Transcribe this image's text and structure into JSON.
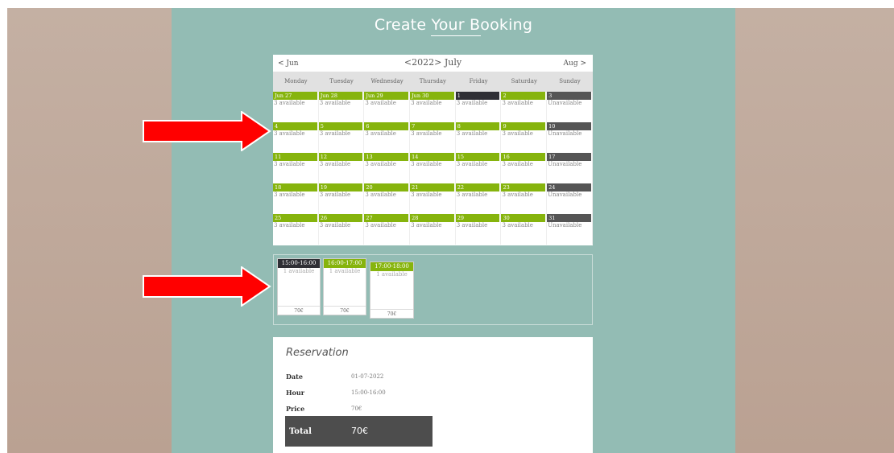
{
  "page": {
    "title": "Create Your Booking"
  },
  "calendar": {
    "prev_label": "< Jun",
    "month_label": "<2022> July",
    "next_label": "Aug >",
    "weekdays": [
      "Monday",
      "Tuesday",
      "Wednesday",
      "Thursday",
      "Friday",
      "Saturday",
      "Sunday"
    ],
    "weeks": [
      [
        {
          "date": "Jun 27",
          "avail": "3 available",
          "state": "available"
        },
        {
          "date": "Jun 28",
          "avail": "3 available",
          "state": "available"
        },
        {
          "date": "Jun 29",
          "avail": "3 available",
          "state": "available"
        },
        {
          "date": "Jun 30",
          "avail": "3 available",
          "state": "available"
        },
        {
          "date": "1",
          "avail": "3 available",
          "state": "selected"
        },
        {
          "date": "2",
          "avail": "3 available",
          "state": "available"
        },
        {
          "date": "3",
          "avail": "Unavailable",
          "state": "unavailable"
        }
      ],
      [
        {
          "date": "4",
          "avail": "3 available",
          "state": "available"
        },
        {
          "date": "5",
          "avail": "3 available",
          "state": "available"
        },
        {
          "date": "6",
          "avail": "3 available",
          "state": "available"
        },
        {
          "date": "7",
          "avail": "3 available",
          "state": "available"
        },
        {
          "date": "8",
          "avail": "3 available",
          "state": "available"
        },
        {
          "date": "9",
          "avail": "3 available",
          "state": "available"
        },
        {
          "date": "10",
          "avail": "Unavailable",
          "state": "unavailable"
        }
      ],
      [
        {
          "date": "11",
          "avail": "3 available",
          "state": "available"
        },
        {
          "date": "12",
          "avail": "3 available",
          "state": "available"
        },
        {
          "date": "13",
          "avail": "3 available",
          "state": "available"
        },
        {
          "date": "14",
          "avail": "3 available",
          "state": "available"
        },
        {
          "date": "15",
          "avail": "3 available",
          "state": "available"
        },
        {
          "date": "16",
          "avail": "3 available",
          "state": "available"
        },
        {
          "date": "17",
          "avail": "Unavailable",
          "state": "unavailable"
        }
      ],
      [
        {
          "date": "18",
          "avail": "3 available",
          "state": "available"
        },
        {
          "date": "19",
          "avail": "3 available",
          "state": "available"
        },
        {
          "date": "20",
          "avail": "3 available",
          "state": "available"
        },
        {
          "date": "21",
          "avail": "3 available",
          "state": "available"
        },
        {
          "date": "22",
          "avail": "3 available",
          "state": "available"
        },
        {
          "date": "23",
          "avail": "3 available",
          "state": "available"
        },
        {
          "date": "24",
          "avail": "Unavailable",
          "state": "unavailable"
        }
      ],
      [
        {
          "date": "25",
          "avail": "3 available",
          "state": "available"
        },
        {
          "date": "26",
          "avail": "3 available",
          "state": "available"
        },
        {
          "date": "27",
          "avail": "3 available",
          "state": "available"
        },
        {
          "date": "28",
          "avail": "3 available",
          "state": "available"
        },
        {
          "date": "29",
          "avail": "3 available",
          "state": "available"
        },
        {
          "date": "30",
          "avail": "3 available",
          "state": "available"
        },
        {
          "date": "31",
          "avail": "Unavailable",
          "state": "unavailable"
        }
      ]
    ]
  },
  "hours": [
    {
      "time": "15:00-16:00",
      "avail": "1 available",
      "price": "70€",
      "state": "selected"
    },
    {
      "time": "16:00-17:00",
      "avail": "1 available",
      "price": "70€",
      "state": "available"
    },
    {
      "time": "17:00-18:00",
      "avail": "1 available",
      "price": "70€",
      "state": "available"
    }
  ],
  "reservation": {
    "title": "Reservation",
    "date_label": "Date",
    "date_value": "01-07-2022",
    "hour_label": "Hour",
    "hour_value": "15:00-16:00",
    "price_label": "Price",
    "price_value": "70€",
    "total_label": "Total",
    "total_value": "70€"
  },
  "colors": {
    "available": "#86b40d",
    "selected": "#2f2f35",
    "unavailable": "#555555",
    "background": "#93bcb4",
    "arrow": "#ff0000"
  }
}
